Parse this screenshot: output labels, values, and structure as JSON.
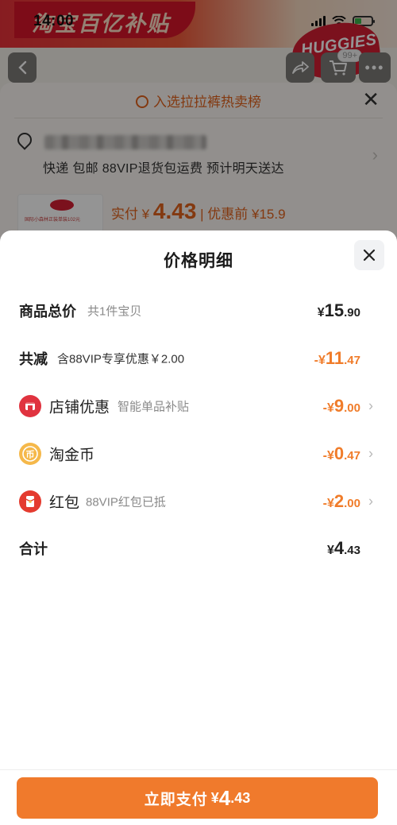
{
  "status_bar": {
    "time": "14:00"
  },
  "background": {
    "banner_text": "淘宝百亿补贴",
    "brand_badge": "HUGGIES",
    "cart_badge": "99+",
    "hot_list": "入选拉拉裤热卖榜",
    "shipping_info": "快递 包邮 88VIP退货包运费 预计明天送达",
    "product_thumb_text": "国际小森林正装单装102元",
    "pay_label": "实付 ¥",
    "pay_amount": "4.43",
    "before_discount": "| 优惠前 ¥15.9"
  },
  "sheet": {
    "title": "价格明细",
    "rows": [
      {
        "label": "商品总价",
        "sub": "共1件宝贝",
        "currency": "¥",
        "int": "15",
        "dec": ".90"
      },
      {
        "label": "共减",
        "sub": "含88VIP专享优惠￥2.00",
        "currency": "-¥",
        "int": "11",
        "dec": ".47"
      },
      {
        "label": "店铺优惠",
        "sub": "智能单品补贴",
        "currency": "-¥",
        "int": "9",
        "dec": ".00",
        "icon": "shop-icon"
      },
      {
        "label": "淘金币",
        "sub": "",
        "currency": "-¥",
        "int": "0",
        "dec": ".47",
        "icon": "coin-icon"
      },
      {
        "label": "红包",
        "sub": "88VIP红包已抵",
        "currency": "-¥",
        "int": "2",
        "dec": ".00",
        "icon": "red-envelope-icon"
      },
      {
        "label": "合计",
        "sub": "",
        "currency": "¥",
        "int": "4",
        "dec": ".43"
      }
    ],
    "pay_button": {
      "label": "立即支付",
      "currency": "¥",
      "int": "4",
      "dec": ".43"
    }
  },
  "colors": {
    "accent": "#f07a2c",
    "discount": "#f07c2a",
    "shop_icon": "#e0333f",
    "coin_icon": "#f5b84a",
    "red_envelope_icon": "#e43b2f"
  }
}
